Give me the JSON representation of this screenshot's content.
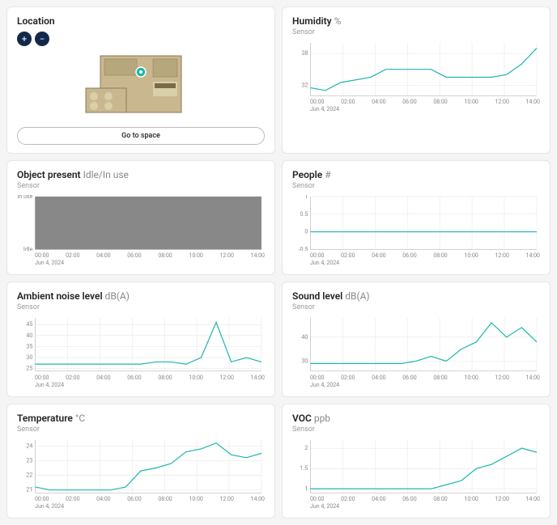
{
  "location": {
    "title": "Location",
    "zoom_in": "+",
    "zoom_out": "−",
    "go_button": "Go to space"
  },
  "common": {
    "sensor_label": "Sensor",
    "date_label": "Jun 4, 2024",
    "x_ticks": [
      "00:00",
      "02:00",
      "04:00",
      "06:00",
      "08:00",
      "10:00",
      "12:00",
      "14:00"
    ]
  },
  "cards": {
    "humidity": {
      "title": "Humidity",
      "unit": "%"
    },
    "object": {
      "title": "Object present",
      "unit": "Idle/In use"
    },
    "people": {
      "title": "People",
      "unit": "#"
    },
    "noise": {
      "title": "Ambient noise level",
      "unit": "dB(A)"
    },
    "sound": {
      "title": "Sound level",
      "unit": "dB(A)"
    },
    "temp": {
      "title": "Temperature",
      "unit": "°C"
    },
    "voc": {
      "title": "VOC",
      "unit": "ppb"
    }
  },
  "chart_data": [
    {
      "id": "humidity",
      "type": "line",
      "title": "Humidity %",
      "xlabel": "",
      "ylabel": "",
      "x": [
        "00:00",
        "02:00",
        "04:00",
        "06:00",
        "08:00",
        "10:00",
        "12:00",
        "14:00"
      ],
      "y_ticks": [
        32,
        38
      ],
      "ylim": [
        30,
        40
      ],
      "series": [
        {
          "name": "Sensor",
          "values": [
            31.5,
            31.0,
            32.5,
            33.0,
            33.5,
            35.0,
            35.0,
            35.0,
            35.0,
            33.5,
            33.5,
            33.5,
            33.5,
            34.0,
            36.0,
            39.0
          ]
        }
      ]
    },
    {
      "id": "object",
      "type": "area",
      "title": "Object present Idle/In use",
      "xlabel": "",
      "ylabel": "",
      "x": [
        "00:00",
        "02:00",
        "04:00",
        "06:00",
        "08:00",
        "10:00",
        "12:00",
        "14:00"
      ],
      "y_ticks_labels": [
        "Idle",
        "In use"
      ],
      "y_ticks": [
        0,
        1
      ],
      "ylim": [
        0,
        1
      ],
      "series": [
        {
          "name": "Sensor",
          "values": [
            1,
            1,
            1,
            1,
            1,
            1,
            1,
            1,
            1,
            1,
            1,
            1,
            1,
            1,
            1,
            1
          ]
        }
      ]
    },
    {
      "id": "people",
      "type": "line",
      "title": "People #",
      "xlabel": "",
      "ylabel": "",
      "x": [
        "00:00",
        "02:00",
        "04:00",
        "06:00",
        "08:00",
        "10:00",
        "12:00",
        "14:00"
      ],
      "y_ticks": [
        -0.5,
        0,
        0.5,
        1
      ],
      "ylim": [
        -0.5,
        1
      ],
      "series": [
        {
          "name": "Sensor",
          "values": [
            0,
            0,
            0,
            0,
            0,
            0,
            0,
            0,
            0,
            0,
            0,
            0,
            0,
            0,
            0,
            0
          ]
        }
      ]
    },
    {
      "id": "noise",
      "type": "line",
      "title": "Ambient noise level dB(A)",
      "xlabel": "",
      "ylabel": "",
      "x": [
        "00:00",
        "02:00",
        "04:00",
        "06:00",
        "08:00",
        "10:00",
        "12:00",
        "14:00"
      ],
      "y_ticks": [
        25,
        30,
        35,
        40,
        45
      ],
      "ylim": [
        24,
        48
      ],
      "series": [
        {
          "name": "Sensor",
          "values": [
            27,
            27,
            27,
            27,
            27,
            27,
            27,
            27,
            28,
            28,
            27,
            30,
            46,
            28,
            30,
            28
          ]
        }
      ]
    },
    {
      "id": "sound",
      "type": "line",
      "title": "Sound level dB(A)",
      "xlabel": "",
      "ylabel": "",
      "x": [
        "00:00",
        "02:00",
        "04:00",
        "06:00",
        "08:00",
        "10:00",
        "12:00",
        "14:00"
      ],
      "y_ticks": [
        30,
        40
      ],
      "ylim": [
        26,
        48
      ],
      "series": [
        {
          "name": "Sensor",
          "values": [
            29,
            29,
            29,
            29,
            29,
            29,
            29,
            30,
            32,
            30,
            35,
            38,
            46,
            40,
            44,
            38
          ]
        }
      ]
    },
    {
      "id": "temp",
      "type": "line",
      "title": "Temperature °C",
      "xlabel": "",
      "ylabel": "",
      "x": [
        "00:00",
        "02:00",
        "04:00",
        "06:00",
        "08:00",
        "10:00",
        "12:00",
        "14:00"
      ],
      "y_ticks": [
        21,
        22,
        23,
        24
      ],
      "ylim": [
        20.8,
        24.4
      ],
      "series": [
        {
          "name": "Sensor",
          "values": [
            21.2,
            21.0,
            21.0,
            21.0,
            21.0,
            21.0,
            21.2,
            22.3,
            22.5,
            22.8,
            23.6,
            23.8,
            24.2,
            23.4,
            23.2,
            23.5
          ]
        }
      ]
    },
    {
      "id": "voc",
      "type": "line",
      "title": "VOC ppb",
      "xlabel": "",
      "ylabel": "",
      "x": [
        "00:00",
        "02:00",
        "04:00",
        "06:00",
        "08:00",
        "10:00",
        "12:00",
        "14:00"
      ],
      "y_ticks": [
        1,
        1.5,
        2
      ],
      "ylim": [
        0.9,
        2.2
      ],
      "series": [
        {
          "name": "Sensor",
          "values": [
            1.0,
            1.0,
            1.0,
            1.0,
            1.0,
            1.0,
            1.0,
            1.0,
            1.0,
            1.1,
            1.2,
            1.5,
            1.6,
            1.8,
            2.0,
            1.9
          ]
        }
      ]
    }
  ]
}
